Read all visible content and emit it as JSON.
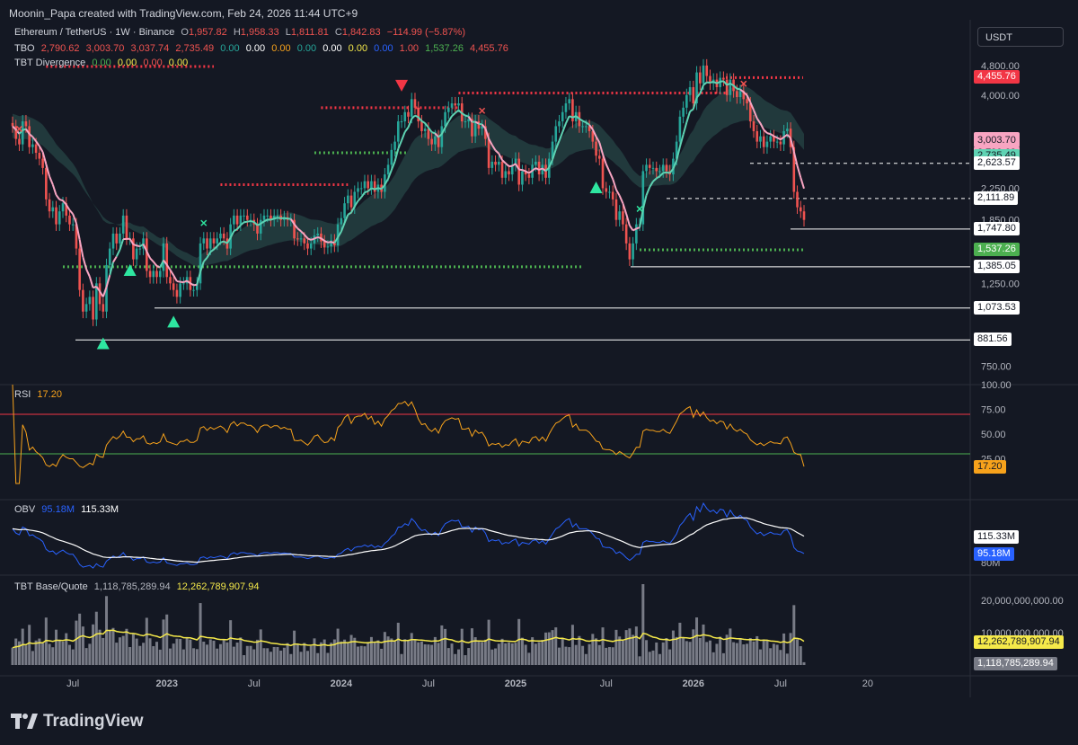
{
  "header": {
    "text": "Moonin_Papa created with TradingView.com, Feb 24, 2026 11:44 UTC+9"
  },
  "symbol": {
    "title": "Ethereum / TetherUS · 1W · Binance",
    "open": "O",
    "open_val": "1,957.82",
    "high": "H",
    "high_val": "1,958.33",
    "low": "L",
    "low_val": "1,811.81",
    "close": "C",
    "close_val": "1,842.83",
    "change": "−114.99 (−5.87%)"
  },
  "tbo": {
    "name": "TBO",
    "values": [
      "2,790.62",
      "3,003.70",
      "3,037.74",
      "2,735.49",
      "0.00",
      "0.00",
      "0.00",
      "0.00",
      "0.00",
      "0.00",
      "0.00",
      "1.00",
      "1,537.26",
      "4,455.76"
    ]
  },
  "tbt_div": {
    "name": "TBT Divergence",
    "values": [
      "0.00",
      "0.00",
      "0.00",
      "0.00"
    ]
  },
  "rsi": {
    "name": "RSI",
    "value": "17.20"
  },
  "obv": {
    "name": "OBV",
    "value1": "95.18M",
    "value2": "115.33M"
  },
  "tbt_bq": {
    "name": "TBT Base/Quote",
    "value1": "1,118,785,289.94",
    "value2": "12,262,789,907.94"
  },
  "currency_button": "USDT",
  "price_axis_labels": [
    "4,800.00",
    "4,000.00",
    "3,000.00",
    "2,250.00",
    "1,850.00",
    "1,250.00",
    "750.00"
  ],
  "price_tags": [
    {
      "text": "4,455.76",
      "price": 4455.76,
      "bg": "#f23645",
      "fg": "#ffffff"
    },
    {
      "text": "3,037.74",
      "price": 3037.74,
      "bg": "#f8a5c2",
      "fg": "#141823"
    },
    {
      "text": "3,003.70",
      "price": 3003.7,
      "bg": "#f8a5c2",
      "fg": "#141823"
    },
    {
      "text": "2,790.62",
      "price": 2790.62,
      "bg": "#f8a5c2",
      "fg": "#141823"
    },
    {
      "text": "2,735.49",
      "price": 2735.49,
      "bg": "#5fd3b3",
      "fg": "#141823"
    },
    {
      "text": "2,623.57",
      "price": 2623.57,
      "bg": "#ffffff",
      "fg": "#141823"
    },
    {
      "text": "2,111.89",
      "price": 2111.89,
      "bg": "#ffffff",
      "fg": "#141823"
    },
    {
      "text": "1,747.80",
      "price": 1747.8,
      "bg": "#ffffff",
      "fg": "#141823"
    },
    {
      "text": "1,537.26",
      "price": 1537.26,
      "bg": "#4caf50",
      "fg": "#ffffff"
    },
    {
      "text": "1,385.05",
      "price": 1385.05,
      "bg": "#ffffff",
      "fg": "#141823"
    },
    {
      "text": "1,073.53",
      "price": 1073.53,
      "bg": "#ffffff",
      "fg": "#141823"
    },
    {
      "text": "881.56",
      "price": 881.56,
      "bg": "#ffffff",
      "fg": "#141823"
    }
  ],
  "rsi_axis_labels": [
    "100.00",
    "75.00",
    "50.00",
    "25.00"
  ],
  "rsi_tag": "17.20",
  "obv_axis_labels": [
    "115.33M",
    "95.18M",
    "80M"
  ],
  "vol_axis_labels": [
    "20,000,000,000.00",
    "12,262,789,907.94",
    "10,000,000,000.00",
    "1,118,785,289.94"
  ],
  "time_axis_labels": [
    "Jul",
    "2023",
    "Jul",
    "2024",
    "Jul",
    "2025",
    "Jul",
    "2026",
    "Jul",
    "20"
  ],
  "footer": {
    "logo_text": "TradingView"
  },
  "colors": {
    "up": "#26a69a",
    "down": "#ef5350",
    "ema_fast": "#f8a5c2",
    "ema_slow": "#5fd3b3",
    "rsi": "#f7a21b",
    "obv": "#2962ff",
    "obv_ma": "#ffffff",
    "vol": "#787b86",
    "vol_ma": "#f5e94a",
    "dot_red": "#f23645",
    "dot_green": "#4caf50"
  },
  "chart_data": {
    "type": "candlestick",
    "title": "Ethereum / TetherUS · 1W · Binance",
    "x_ticks": [
      "Jul",
      "2023",
      "Jul",
      "2024",
      "Jul",
      "2025",
      "Jul",
      "2026",
      "Jul",
      "20"
    ],
    "y_scale": "log",
    "ylim": [
      680,
      5100
    ],
    "ohlc_last": {
      "open": 1957.82,
      "high": 1958.33,
      "low": 1811.81,
      "close": 1842.83
    },
    "close_series": [
      3300,
      3050,
      2950,
      3400,
      3300,
      2900,
      2950,
      2800,
      2700,
      2550,
      2100,
      1950,
      2000,
      1800,
      1950,
      2050,
      1900,
      1800,
      1800,
      1550,
      1200,
      1050,
      1100,
      1150,
      1000,
      1250,
      1100,
      1050,
      1400,
      1550,
      1700,
      1600,
      1700,
      1900,
      1650,
      1650,
      1450,
      1550,
      1550,
      1650,
      1350,
      1300,
      1350,
      1300,
      1350,
      1600,
      1300,
      1250,
      1200,
      1150,
      1250,
      1250,
      1300,
      1200,
      1200,
      1250,
      1600,
      1650,
      1550,
      1650,
      1600,
      1650,
      1700,
      1650,
      1550,
      1800,
      1900,
      1800,
      1900,
      1900,
      1850,
      1850,
      1800,
      1700,
      1850,
      1900,
      1900,
      1850,
      1900,
      1900,
      1850,
      1880,
      1850,
      1850,
      1650,
      1640,
      1650,
      1600,
      1550,
      1600,
      1680,
      1700,
      1620,
      1560,
      1570,
      1630,
      1580,
      1800,
      1870,
      2050,
      2150,
      2000,
      2200,
      2250,
      2250,
      2350,
      2250,
      2350,
      2200,
      2300,
      2200,
      2450,
      2600,
      2850,
      3000,
      3400,
      3400,
      3600,
      3500,
      3900,
      3700,
      3400,
      3200,
      3250,
      3050,
      2950,
      3100,
      2900,
      3300,
      3600,
      3700,
      3800,
      3750,
      3800,
      3400,
      3400,
      3450,
      3100,
      3400,
      3250,
      3300,
      3050,
      2550,
      2650,
      2600,
      2650,
      2400,
      2500,
      2450,
      2600,
      2700,
      2300,
      2500,
      2450,
      2400,
      2600,
      2650,
      2450,
      2600,
      2400,
      2700,
      3000,
      3300,
      3400,
      3600,
      3800,
      3900,
      3400,
      3600,
      3300,
      3300,
      3300,
      3200,
      3000,
      2750,
      2700,
      2250,
      2200,
      2200,
      2100,
      1850,
      1950,
      1800,
      1600,
      1450,
      1600,
      1800,
      1800,
      2500,
      2600,
      2550,
      2550,
      2500,
      2500,
      2600,
      2500,
      2450,
      2700,
      3000,
      3500,
      3700,
      4000,
      4200,
      3800,
      4600,
      4300,
      4800,
      4500,
      4300,
      4400,
      4200,
      4450,
      4400,
      4000,
      4400,
      4100,
      3950,
      4100,
      3900,
      3800,
      3400,
      3200,
      3000,
      3100,
      2900,
      3000,
      3100,
      3000,
      3000,
      2950,
      3200,
      3250,
      2900,
      2200,
      2000,
      1950,
      1850
    ],
    "rsi_value": 17.2,
    "obv_value": "95.18M",
    "obv_ma_value": "115.33M",
    "volume_ma_value": "12,262,789,907.94",
    "last_volume": "1,118,785,289.94"
  }
}
